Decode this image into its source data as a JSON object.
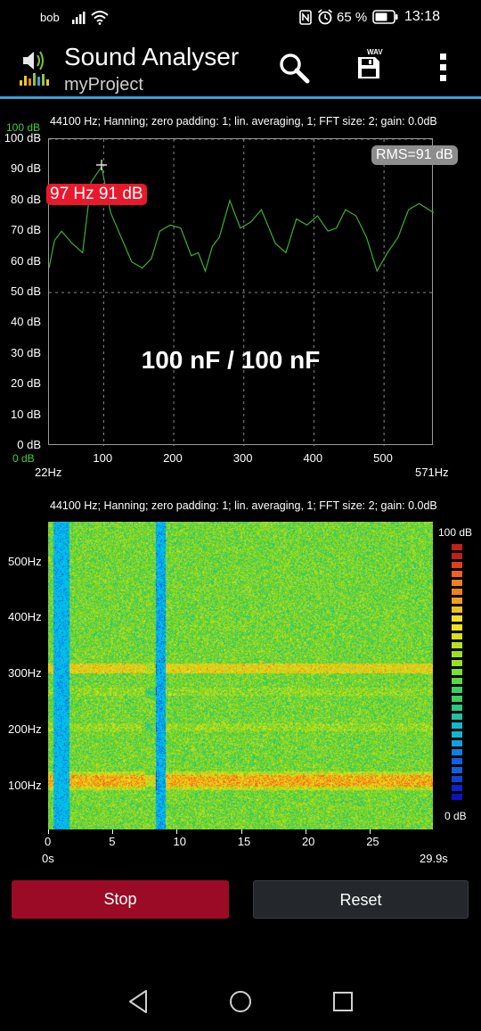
{
  "status_bar": {
    "carrier": "bob",
    "battery_percent": "65 %",
    "time": "13:18",
    "icons": [
      "signal-icon",
      "wifi-icon",
      "nfc-icon",
      "alarm-icon",
      "battery-icon"
    ]
  },
  "app_bar": {
    "title": "Sound Analyser",
    "subtitle": "myProject",
    "icons": [
      "app-logo-icon",
      "search-icon",
      "save-wav-icon",
      "overflow-menu-icon"
    ],
    "save_badge": "WAV",
    "accent_color": "#3aa0d8"
  },
  "spectrum": {
    "info": "44100 Hz; Hanning; zero padding: 1; lin. averaging, 1; FFT size: 2; gain: 0.0dB",
    "range_top_green": "100 dB",
    "range_bottom_green": "0 dB",
    "y_ticks": [
      "100 dB",
      "90 dB",
      "80 dB",
      "70 dB",
      "60 dB",
      "50 dB",
      "40 dB",
      "30 dB",
      "20 dB",
      "10 dB",
      "0 dB"
    ],
    "x_start": "22Hz",
    "x_end": "571Hz",
    "x_ticks": [
      "100",
      "200",
      "300",
      "400",
      "500"
    ],
    "rms": "RMS=91 dB",
    "peak": "97 Hz  91 dB",
    "overlay_text": "100 nF / 100 nF"
  },
  "chart_data": {
    "type": "line",
    "x": [
      22,
      30,
      40,
      55,
      70,
      82,
      97,
      110,
      125,
      140,
      155,
      168,
      180,
      195,
      210,
      225,
      235,
      245,
      255,
      265,
      280,
      295,
      310,
      325,
      345,
      360,
      375,
      390,
      405,
      420,
      432,
      445,
      460,
      475,
      490,
      505,
      520,
      535,
      550,
      571
    ],
    "y": [
      58,
      67,
      70,
      66,
      63,
      86,
      91,
      76,
      68,
      60,
      58,
      61,
      70,
      72,
      71,
      62,
      63,
      57,
      65,
      68,
      80,
      71,
      73,
      77,
      66,
      63,
      74,
      72,
      75,
      70,
      71,
      77,
      75,
      68,
      57,
      63,
      68,
      77,
      79,
      76
    ],
    "xlim": [
      22,
      571
    ],
    "ylim": [
      0,
      100
    ],
    "series": [
      {
        "name": "",
        "color": "#3fae33"
      }
    ],
    "grid": true
  },
  "spectrogram": {
    "info": "44100 Hz; Hanning; zero padding: 1; lin. averaging, 1; FFT size: 2; gain: 0.0dB",
    "y_ticks": [
      "500Hz",
      "400Hz",
      "300Hz",
      "200Hz",
      "100Hz"
    ],
    "x_ticks": [
      "0",
      "5",
      "10",
      "15",
      "20",
      "25"
    ],
    "t_start": "0s",
    "t_end": "29.9s",
    "scale_top": "100 dB",
    "scale_bottom": "0 dB"
  },
  "buttons": {
    "stop": "Stop",
    "reset": "Reset"
  },
  "nav": {
    "icons": [
      "back-icon",
      "home-icon",
      "recents-icon"
    ]
  }
}
